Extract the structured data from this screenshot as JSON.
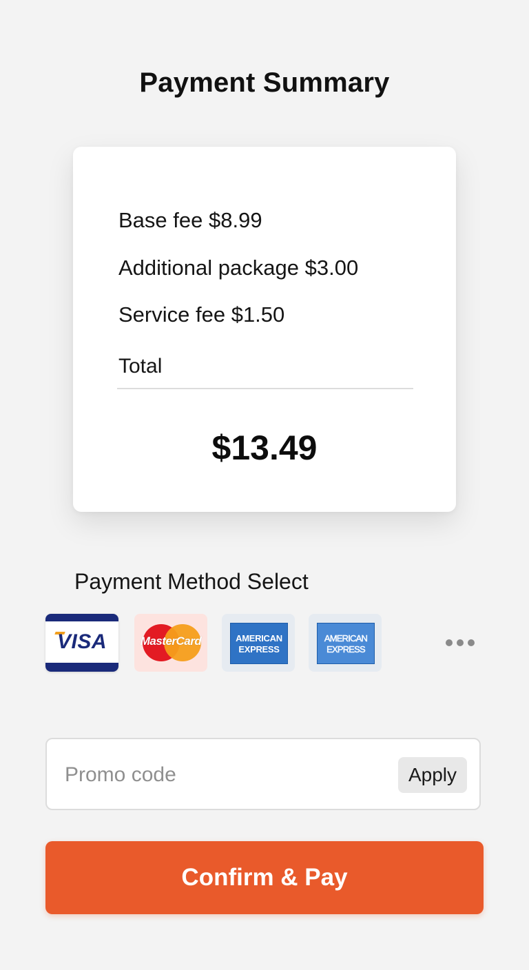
{
  "header": {
    "title": "Payment Summary"
  },
  "summary": {
    "line_items": [
      {
        "label": "Base fee",
        "amount": "$8.99"
      },
      {
        "label": "Additional package",
        "amount": "$3.00"
      },
      {
        "label": "Service fee",
        "amount": "$1.50"
      }
    ],
    "total_label": "Total",
    "total_amount": "$13.49"
  },
  "payment_methods": {
    "title": "Payment Method Select",
    "cards": [
      {
        "name": "visa",
        "logo_text": "VISA",
        "color": "#1a2a7a"
      },
      {
        "name": "mastercard",
        "logo_text": "MasterCard",
        "colors": [
          "#e31b23",
          "#f59e1b"
        ]
      },
      {
        "name": "amex",
        "logo_lines": [
          "AMERICAN",
          "EXPRESS"
        ],
        "color": "#2f73c5"
      },
      {
        "name": "amex-alt",
        "logo_lines": [
          "AMERICAN",
          "EXPRESS"
        ],
        "color": "#4a8ad6"
      }
    ],
    "more_icon": "more-horizontal-icon"
  },
  "promo": {
    "placeholder": "Promo code",
    "value": "",
    "apply_label": "Apply"
  },
  "confirm": {
    "label": "Confirm & Pay",
    "color": "#e95a2b"
  }
}
